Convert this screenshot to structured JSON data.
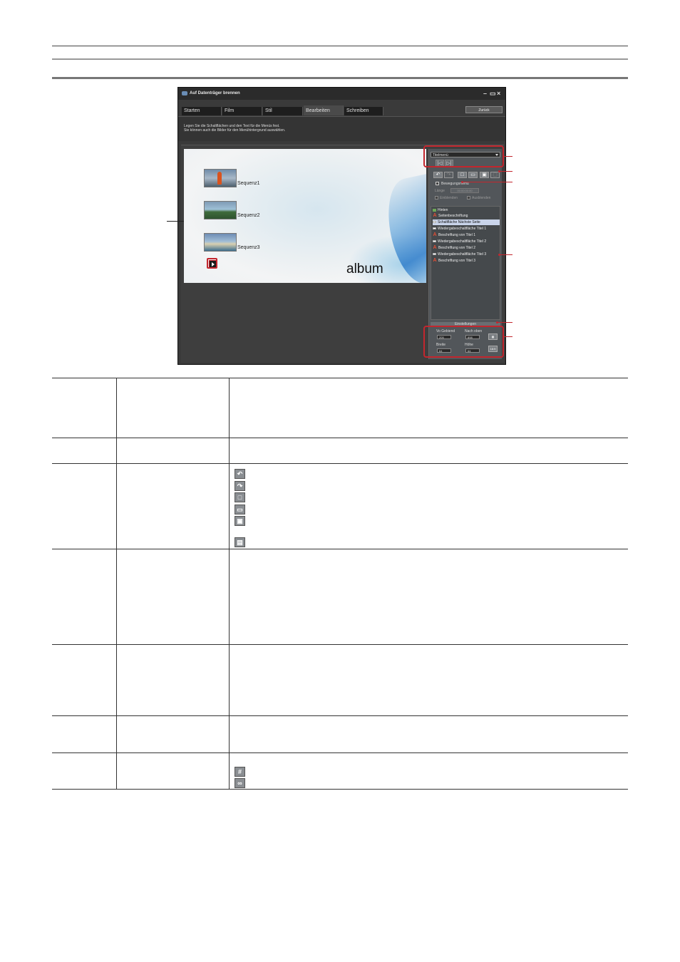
{
  "window": {
    "title": "Auf Datenträger brennen",
    "controls": {
      "minimize": "–",
      "restore": "▭",
      "close": "×"
    },
    "tabs": [
      {
        "label": "Starten"
      },
      {
        "label": "Film"
      },
      {
        "label": "Stil"
      },
      {
        "label": "Bearbeiten",
        "active": true
      },
      {
        "label": "Schreiben"
      }
    ],
    "back_button": "Zurück",
    "instructions": [
      "Legen Sie die Schaltflächen und den Text für die Menüs fest.",
      "Sie können auch die Bilder für den Menühintergrund auswählen."
    ]
  },
  "preview": {
    "items": [
      {
        "label": "Sequenz1"
      },
      {
        "label": "Sequenz2"
      },
      {
        "label": "Sequenz3"
      }
    ],
    "album_text": "album"
  },
  "panel": {
    "menu_select": "Titelmenü",
    "motion_menu_label": "Bewegungsmenü",
    "length_label": "Länge",
    "length_value": "00:00:00:00",
    "fade_in_label": "Einblenden",
    "fade_out_label": "Ausblenden",
    "list_items": [
      {
        "icon": "image",
        "label": "Hinten"
      },
      {
        "icon": "text",
        "label": "Seitenbeschriftung"
      },
      {
        "icon": "button",
        "label": "Schaltfläche Nächste Seite",
        "selected": true
      },
      {
        "icon": "button",
        "label": "Wiedergabeschaltfläche Titel 1"
      },
      {
        "icon": "text",
        "label": "Beschriftung von Titel 1"
      },
      {
        "icon": "button",
        "label": "Wiedergabeschaltfläche Titel 2"
      },
      {
        "icon": "text",
        "label": "Beschriftung von Titel 2"
      },
      {
        "icon": "button",
        "label": "Wiedergabeschaltfläche Titel 3"
      },
      {
        "icon": "text",
        "label": "Beschriftung von Titel 3"
      }
    ],
    "settings_label": "Einstellungen",
    "pos_left_label": "Vo Gebiend",
    "pos_top_label": "Nach oben",
    "pos_left_value": "205",
    "pos_top_value": "898",
    "width_label": "Breite",
    "height_label": "Höhe",
    "width_value": "64",
    "height_value": "64",
    "ratio_button": "16:9"
  },
  "accent_color": "#c3262e"
}
